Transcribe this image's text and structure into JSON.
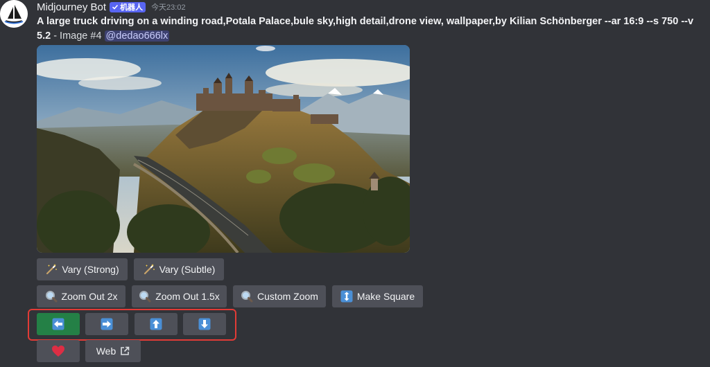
{
  "author": {
    "name": "Midjourney Bot",
    "bot_tag": "机器人",
    "timestamp": "今天23:02"
  },
  "message": {
    "prompt": "A large truck driving on a winding road,Potala Palace,bule sky,high detail,drone view, wallpaper,by Kilian Schönberger --ar 16:9 --s 750 --v 5.2",
    "suffix": " - Image #4 ",
    "mention": "@dedao666lx"
  },
  "image": {
    "subject": "castle on hill with winding road"
  },
  "buttons": {
    "row1": [
      {
        "label": "Vary (Strong)",
        "icon": "magic-wand-icon"
      },
      {
        "label": "Vary (Subtle)",
        "icon": "magic-wand-icon"
      }
    ],
    "row2": [
      {
        "label": "Zoom Out 2x",
        "icon": "magnifier-icon"
      },
      {
        "label": "Zoom Out 1.5x",
        "icon": "magnifier-icon"
      },
      {
        "label": "Custom Zoom",
        "icon": "magnifier-icon"
      },
      {
        "label": "Make Square",
        "icon": "up-down-arrow-icon"
      }
    ],
    "pan": [
      {
        "icon": "arrow-left-icon",
        "state": "selected"
      },
      {
        "icon": "arrow-right-icon"
      },
      {
        "icon": "arrow-up-icon"
      },
      {
        "icon": "arrow-down-icon"
      }
    ],
    "row4": [
      {
        "icon": "heart-icon"
      },
      {
        "label": "Web",
        "icon": "external-link-icon"
      }
    ]
  },
  "colors": {
    "background": "#313338",
    "button": "#4e5058",
    "selected_button": "#248046",
    "highlight": "#e23b36",
    "blurple": "#5865f2",
    "arrow_tile": "#4a8fd6",
    "heart": "#dd2e44"
  }
}
